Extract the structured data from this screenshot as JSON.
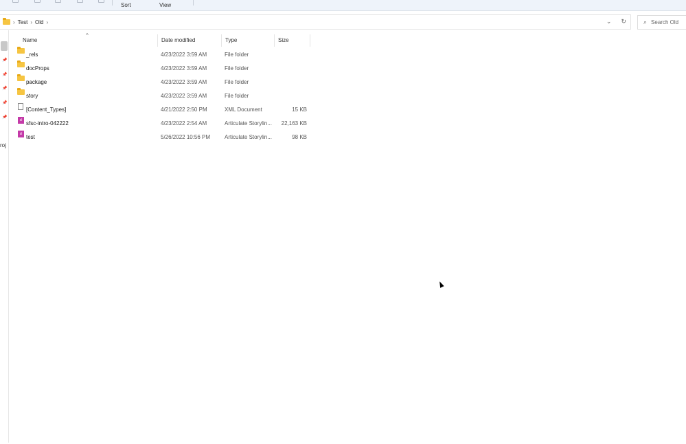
{
  "toolbar": {
    "sort_label": "Sort",
    "view_label": "View"
  },
  "address_bar": {
    "crumbs": [
      "Test",
      "Old"
    ],
    "separator": "›"
  },
  "search": {
    "placeholder": "Search Old"
  },
  "nav": {
    "partial_label": "roj"
  },
  "columns": {
    "name": "Name",
    "date": "Date modified",
    "type": "Type",
    "size": "Size"
  },
  "files": [
    {
      "name": "_rels",
      "date": "4/23/2022 3:59 AM",
      "type": "File folder",
      "size": "",
      "icon": "folder"
    },
    {
      "name": "docProps",
      "date": "4/23/2022 3:59 AM",
      "type": "File folder",
      "size": "",
      "icon": "folder"
    },
    {
      "name": "package",
      "date": "4/23/2022 3:59 AM",
      "type": "File folder",
      "size": "",
      "icon": "folder"
    },
    {
      "name": "story",
      "date": "4/23/2022 3:59 AM",
      "type": "File folder",
      "size": "",
      "icon": "folder"
    },
    {
      "name": "[Content_Types]",
      "date": "4/21/2022 2:50 PM",
      "type": "XML Document",
      "size": "15 KB",
      "icon": "document"
    },
    {
      "name": "sfsc-intro-042222",
      "date": "4/23/2022 2:54 AM",
      "type": "Articulate Storylin...",
      "size": "22,163 KB",
      "icon": "storyline"
    },
    {
      "name": "test",
      "date": "5/26/2022 10:56 PM",
      "type": "Articulate Storylin...",
      "size": "98 KB",
      "icon": "storyline"
    }
  ],
  "colors": {
    "folder": "#f6c542",
    "storyline": "#c43aa8",
    "toolbar_bg": "#eef3fa"
  }
}
